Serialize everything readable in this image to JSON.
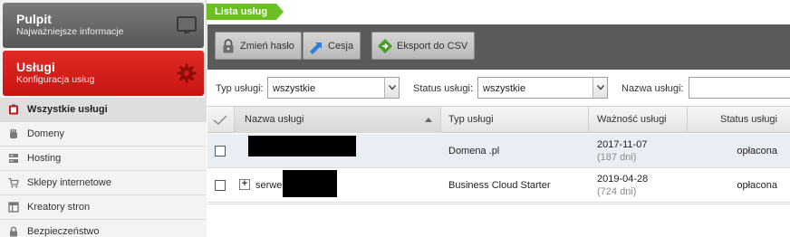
{
  "sidebar": {
    "pulpit": {
      "title": "Pulpit",
      "subtitle": "Najważniejsze informacje"
    },
    "uslugi": {
      "title": "Usługi",
      "subtitle": "Konfiguracja usług"
    },
    "items": [
      {
        "label": "Wszystkie usługi",
        "icon": "clipboard-icon"
      },
      {
        "label": "Domeny",
        "icon": "hand-icon"
      },
      {
        "label": "Hosting",
        "icon": "server-icon"
      },
      {
        "label": "Sklepy internetowe",
        "icon": "cart-icon"
      },
      {
        "label": "Kreatory stron",
        "icon": "layout-icon"
      },
      {
        "label": "Bezpieczeństwo",
        "icon": "lock-icon"
      }
    ]
  },
  "breadcrumb": {
    "label": "Lista usług"
  },
  "toolbar": {
    "change_password": "Zmień hasło",
    "cession": "Cesja",
    "export_csv": "Eksport do CSV"
  },
  "filters": {
    "service_type_label": "Typ usługi:",
    "service_type_value": "wszystkie",
    "service_status_label": "Status usługi:",
    "service_status_value": "wszystkie",
    "service_name_label": "Nazwa usługi:",
    "service_name_value": ""
  },
  "table": {
    "columns": {
      "name": "Nazwa usługi",
      "type": "Typ usługi",
      "validity": "Ważność usługi",
      "status": "Status usługi"
    },
    "rows": [
      {
        "name": "",
        "type": "Domena .pl",
        "date": "2017-11-07",
        "days": "(187 dni)",
        "status": "opłacona"
      },
      {
        "name": "serwer",
        "type": "Business Cloud Starter",
        "date": "2019-04-28",
        "days": "(724 dni)",
        "status": "opłacona"
      }
    ]
  },
  "colors": {
    "active_tile": "#d41b17",
    "breadcrumb": "#6bbf22",
    "toolbar": "#5b5b5b"
  }
}
